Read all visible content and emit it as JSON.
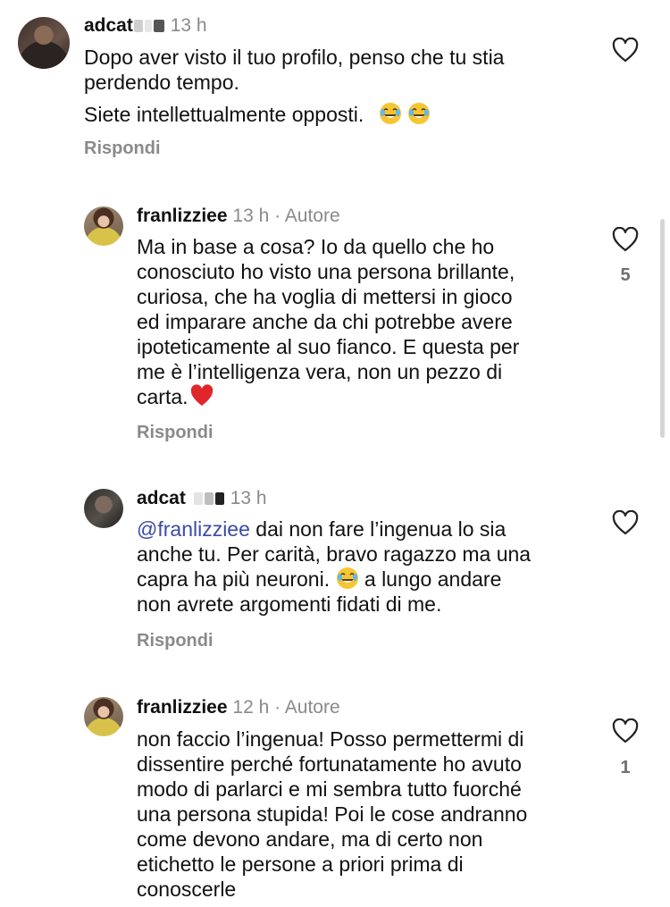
{
  "comments": [
    {
      "username": "adcat",
      "time": "13 h",
      "lines": [
        "Dopo aver visto il tuo profilo, penso che tu stia",
        "perdendo tempo."
      ],
      "extra_line": "Siete intellettualmente opposti.",
      "reply": "Rispondi"
    },
    {
      "username": "franlizziee",
      "time": "13 h",
      "author_label": "· Autore",
      "lines": [
        "Ma in base a cosa? Io da quello che ho",
        "conosciuto ho visto una persona brillante,",
        "curiosa, che ha voglia di mettersi in gioco",
        "ed imparare anche da chi potrebbe avere",
        "ipoteticamente al suo fianco. E questa per",
        "me è l’intelligenza vera, non un pezzo di",
        "carta."
      ],
      "reply": "Rispondi",
      "likes": "5"
    },
    {
      "username": "adcat",
      "time": "13 h",
      "mention": "@franlizziee",
      "lines": [
        " dai non fare l’ingenua lo sia",
        "anche tu. Per carità, bravo ragazzo ma una",
        "capra ha più neuroni.",
        " a lungo andare",
        "non avrete argomenti fidati di me."
      ],
      "reply": "Rispondi"
    },
    {
      "username": "franlizziee",
      "time": "12 h",
      "author_label": "· Autore",
      "lines": [
        "non faccio l’ingenua! Posso permettermi di",
        "dissentire perché fortunatamente ho avuto",
        "modo di parlarci e mi sembra tutto fuorché",
        "una persona stupida! Poi le cose andranno",
        "come devono andare, ma di certo non",
        "etichetto le persone a priori prima di",
        "conoscerle"
      ],
      "likes": "1"
    }
  ],
  "icons": {
    "heart": "heart-outline-icon",
    "laugh": "face-with-tears-of-joy-icon",
    "red_heart": "red-heart-icon"
  },
  "colors": {
    "mention": "#3b4aa8",
    "meta": "#8a8a8a",
    "red_heart": "#e0262b",
    "emoji_yellow": "#f7c531"
  }
}
